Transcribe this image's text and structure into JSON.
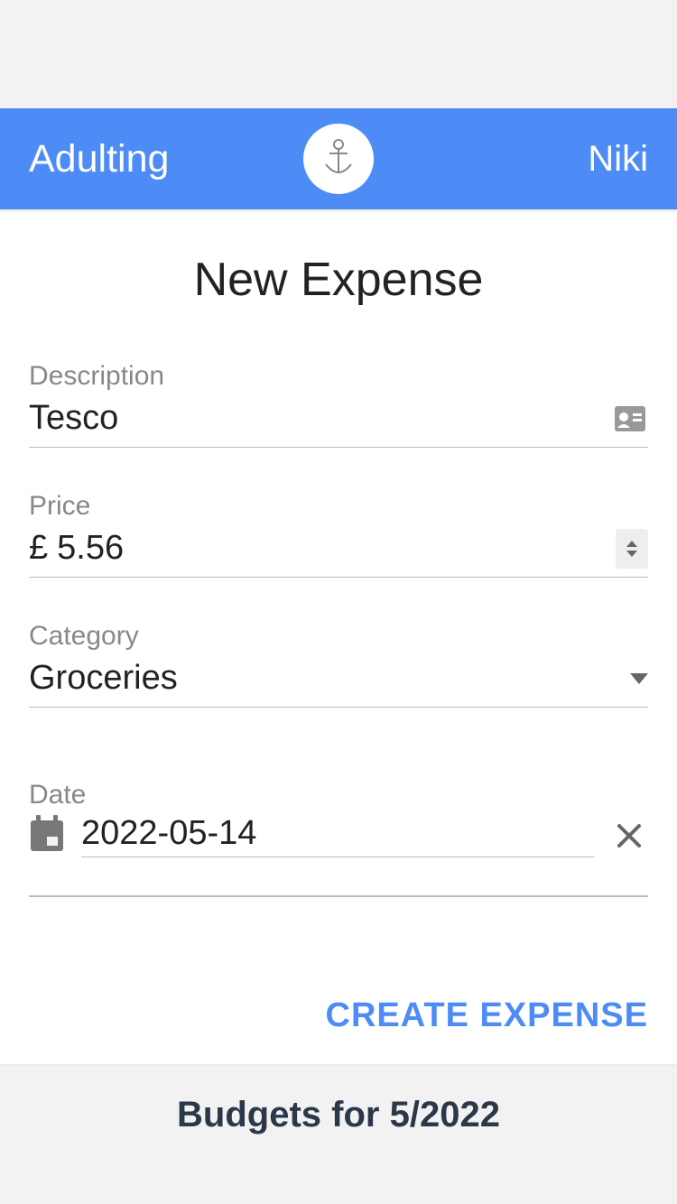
{
  "header": {
    "app_name": "Adulting",
    "user_name": "Niki"
  },
  "form": {
    "title": "New Expense",
    "description": {
      "label": "Description",
      "value": "Tesco"
    },
    "price": {
      "label": "Price",
      "currency": "£",
      "value": "5.56"
    },
    "category": {
      "label": "Category",
      "value": "Groceries"
    },
    "date": {
      "label": "Date",
      "value": "2022-05-14"
    },
    "submit_label": "CREATE EXPENSE"
  },
  "budgets": {
    "title": "Budgets for 5/2022"
  }
}
